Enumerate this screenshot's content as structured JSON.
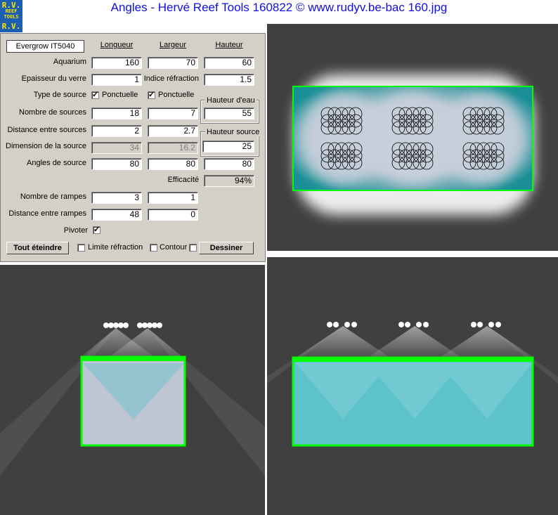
{
  "window": {
    "title": "Angles - Hervé Reef Tools 160822 © www.rudyv.be-bac 160.jpg"
  },
  "logo": {
    "lines": [
      "R.V.",
      "REEF",
      "TOOLS",
      "R.V."
    ]
  },
  "form": {
    "model_name": "Evergrow IT5040",
    "col_headers": [
      "Longueur",
      "Largeur",
      "Hauteur"
    ],
    "aquarium": {
      "label": "Aquarium",
      "values": [
        "160",
        "70",
        "60"
      ]
    },
    "glass": {
      "label": "Epaisseur du verre",
      "value": "1",
      "refraction_label": "Indice réfraction",
      "refraction_value": "1.5"
    },
    "source_type": {
      "label": "Type de source",
      "opt1": "Ponctuelle",
      "opt2": "Ponctuelle",
      "checked1": true,
      "checked2": true
    },
    "water_height": {
      "label": "Hauteur d'eau",
      "value": "55"
    },
    "source_count": {
      "label": "Nombre de sources",
      "values": [
        "18",
        "7"
      ]
    },
    "source_distance": {
      "label": "Distance entre sources",
      "values": [
        "2",
        "2.7"
      ]
    },
    "source_height": {
      "label": "Hauteur source",
      "value": "25"
    },
    "source_dimension": {
      "label": "Dimension de la source",
      "values": [
        "34",
        "16.2"
      ]
    },
    "source_angles": {
      "label": "Angles de source",
      "values": [
        "80",
        "80",
        "80"
      ]
    },
    "efficiency": {
      "label": "Efficacité",
      "value": "94%"
    },
    "ramp_count": {
      "label": "Nombre de rampes",
      "values": [
        "3",
        "1"
      ]
    },
    "ramp_distance": {
      "label": "Distance entre rampes",
      "values": [
        "48",
        "0"
      ]
    },
    "pivot": {
      "label": "Pivoter",
      "checked": true
    },
    "buttons": {
      "off": "Tout éteindre",
      "draw": "Dessiner"
    },
    "checks": {
      "limit": "Limite réfraction",
      "contour": "Contour"
    }
  },
  "colors": {
    "tank_border": "#00ff00",
    "water": "#5fc4cc",
    "background": "#404040",
    "title": "#1010e0"
  }
}
